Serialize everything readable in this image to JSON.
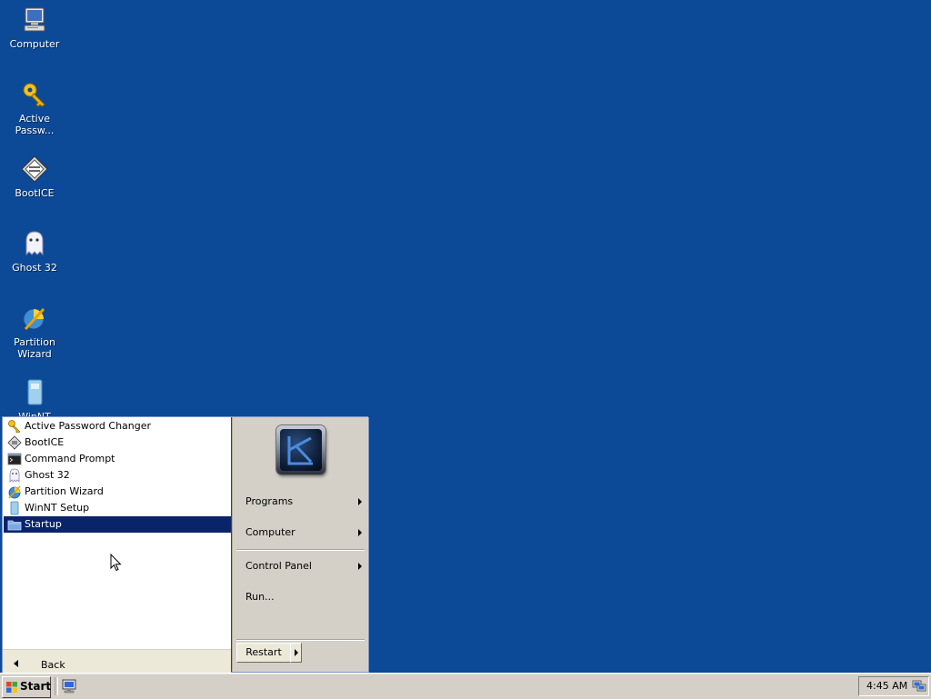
{
  "desktop": {
    "background_color": "#0c4a98",
    "icons": [
      {
        "label": "Computer",
        "icon": "computer-icon"
      },
      {
        "label": "Active Passw...",
        "icon": "key-icon"
      },
      {
        "label": "BootICE",
        "icon": "bootice-icon"
      },
      {
        "label": "Ghost 32",
        "icon": "ghost-icon"
      },
      {
        "label": "Partition Wizard",
        "icon": "partition-wizard-icon"
      },
      {
        "label": "WinNT Setup",
        "icon": "winnt-setup-icon"
      }
    ]
  },
  "start_menu": {
    "programs": [
      {
        "label": "Active Password Changer",
        "icon": "key-icon"
      },
      {
        "label": "BootICE",
        "icon": "bootice-icon"
      },
      {
        "label": "Command Prompt",
        "icon": "command-prompt-icon"
      },
      {
        "label": "Ghost 32",
        "icon": "ghost-icon"
      },
      {
        "label": "Partition Wizard",
        "icon": "partition-wizard-icon"
      },
      {
        "label": "WinNT Setup",
        "icon": "winnt-setup-icon"
      },
      {
        "label": "Startup",
        "icon": "folder-icon",
        "selected": true
      }
    ],
    "back_label": "Back",
    "right_items": [
      {
        "label": "Programs",
        "has_submenu": true
      },
      {
        "label": "Computer",
        "has_submenu": true
      },
      {
        "label": "Control Panel",
        "has_submenu": true
      },
      {
        "label": "Run...",
        "has_submenu": false
      }
    ],
    "restart_label": "Restart",
    "selection_color": "#0a246a"
  },
  "taskbar": {
    "start_label": "Start",
    "clock": "4:45 AM",
    "quick_launch_icon": "show-desktop-icon",
    "tray_icon": "network-icon"
  }
}
